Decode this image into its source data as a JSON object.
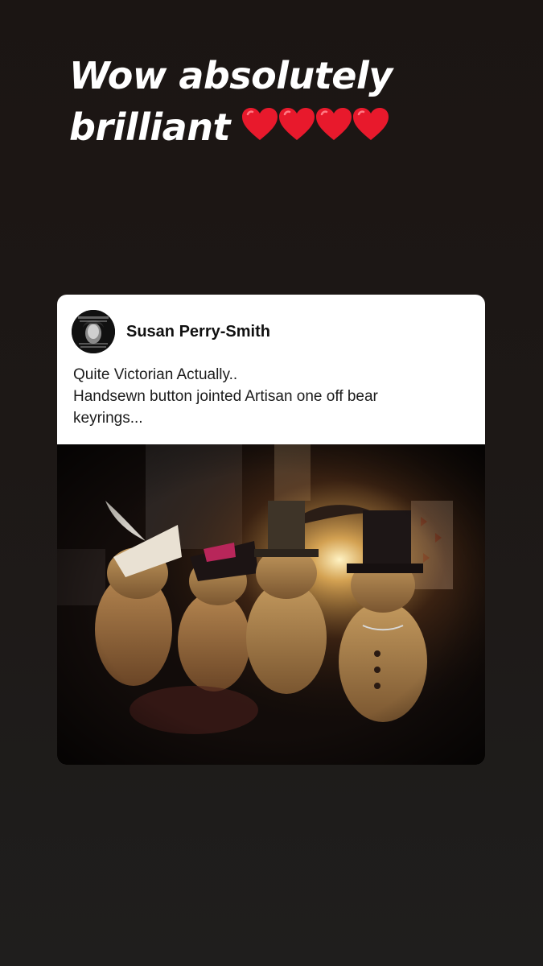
{
  "story": {
    "caption_line1": "Wow absolutely",
    "caption_line2": "brilliant",
    "heart_count": 4,
    "heart_color": "#e8192c",
    "background_color": "#1c1715"
  },
  "shared_post": {
    "author": "Susan Perry-Smith",
    "avatar": "profile-avatar",
    "text_line1": "Quite Victorian Actually..",
    "text_line2": "Handsewn button jointed Artisan one off  bear",
    "text_line3": "keyrings...",
    "image": "photo-of-teddy-bear-keyrings-in-hats"
  }
}
